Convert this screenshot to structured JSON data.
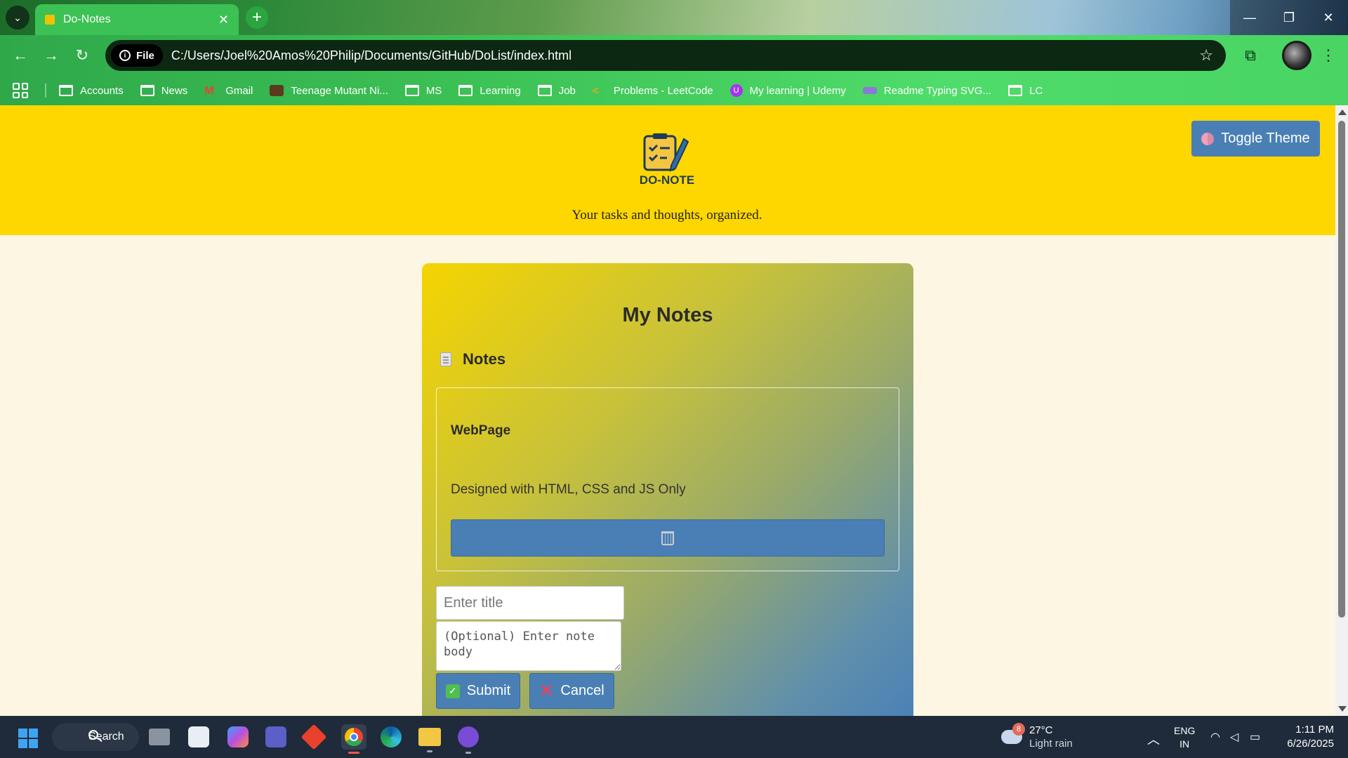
{
  "browser": {
    "tab_title": "Do-Notes",
    "tab_close": "✕",
    "new_tab": "+",
    "file_chip": "File",
    "url": "C:/Users/Joel%20Amos%20Philip/Documents/GitHub/DoList/index.html",
    "bookmarks": [
      {
        "label": "Accounts",
        "icon": "folder-icon"
      },
      {
        "label": "News",
        "icon": "folder-icon"
      },
      {
        "label": "Gmail",
        "icon": "gmail-icon"
      },
      {
        "label": "Teenage Mutant Ni...",
        "icon": "tmnt-icon"
      },
      {
        "label": "MS",
        "icon": "folder-icon"
      },
      {
        "label": "Learning",
        "icon": "folder-icon"
      },
      {
        "label": "Job",
        "icon": "folder-icon"
      },
      {
        "label": "Problems - LeetCode",
        "icon": "leetcode-icon"
      },
      {
        "label": "My learning | Udemy",
        "icon": "udemy-icon"
      },
      {
        "label": "Readme Typing SVG...",
        "icon": "keyboard-icon"
      },
      {
        "label": "LC",
        "icon": "folder-icon"
      }
    ]
  },
  "header": {
    "logo_text": "DO-NOTE",
    "tagline": "Your tasks and thoughts, organized.",
    "toggle_theme": "Toggle Theme"
  },
  "notes": {
    "title": "My Notes",
    "section_label": "Notes",
    "items": [
      {
        "title": "WebPage",
        "body": "Designed with HTML, CSS and JS Only"
      }
    ],
    "title_placeholder": "Enter title",
    "body_placeholder": "(Optional) Enter note body",
    "submit_label": "Submit",
    "cancel_label": "Cancel"
  },
  "taskbar": {
    "search_label": "Search",
    "weather_badge": "8",
    "temperature": "27°C",
    "weather_desc": "Light rain",
    "lang_primary": "ENG",
    "lang_secondary": "IN",
    "time": "1:11 PM",
    "date": "6/26/2025"
  },
  "colors": {
    "header_bg": "#ffd700",
    "button_blue": "#4a7fb5",
    "page_bg": "#fdf6e3",
    "taskbar_bg": "#1f2a3a"
  }
}
